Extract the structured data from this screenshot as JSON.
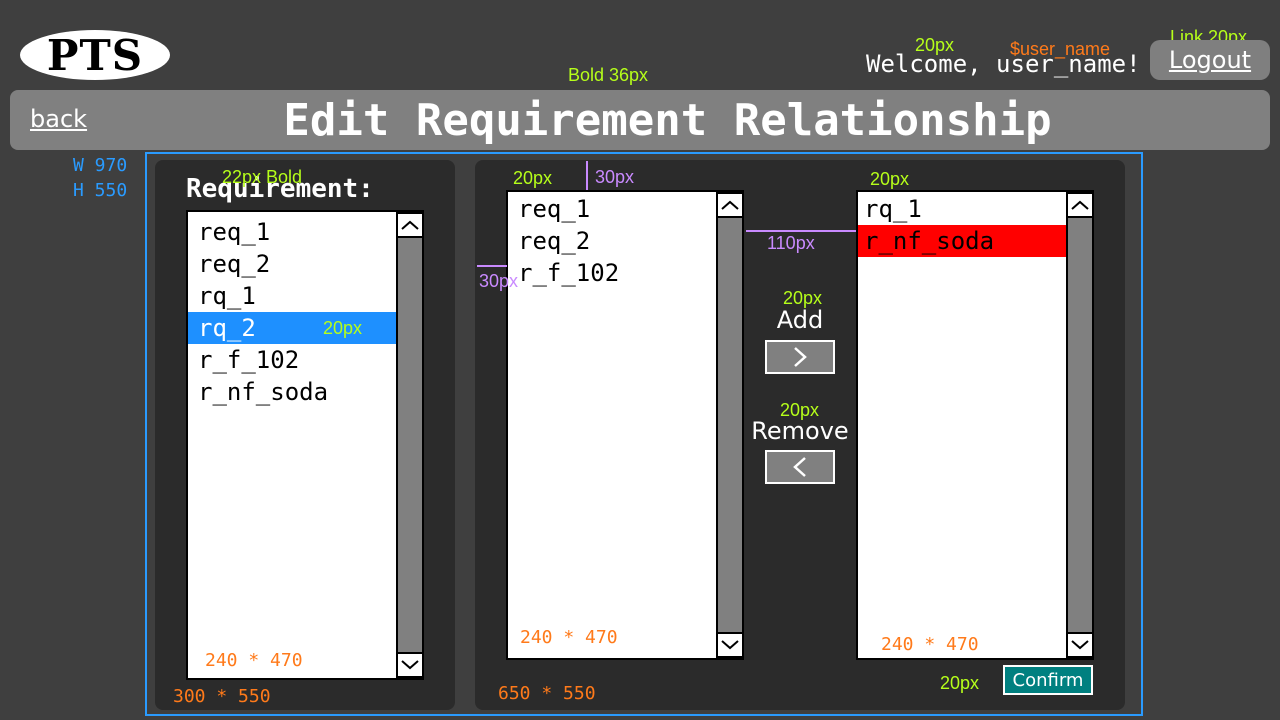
{
  "app": {
    "logo": "PTS",
    "page_title": "Edit Requirement Relationship",
    "back_label": "back"
  },
  "header": {
    "welcome": "Welcome, user_name!",
    "logout_label": "Logout"
  },
  "requirement_panel": {
    "heading": "Requirement:",
    "items": [
      "req_1",
      "req_2",
      "rq_1",
      "rq_2",
      "r_f_102",
      "r_nf_soda"
    ],
    "selected": "rq_2"
  },
  "source_list": {
    "items": [
      "req_1",
      "req_2",
      "r_f_102"
    ]
  },
  "target_list": {
    "items": [
      "rq_1",
      "r_nf_soda"
    ],
    "highlighted": "r_nf_soda"
  },
  "actions": {
    "add_label": "Add",
    "remove_label": "Remove",
    "confirm_label": "Confirm"
  },
  "annotations": {
    "bold36": "Bold 36px",
    "link20": "Link 20px",
    "px20": "20px",
    "user_name_var": "$user_name",
    "bold22": "22px Bold",
    "w970": "W 970",
    "h550": "H 550",
    "px30": "30px",
    "px110": "110px",
    "size_list": "240 * 470",
    "size_left_panel": "300 * 550",
    "size_right_panel": "650 * 550"
  },
  "colors": {
    "background": "#3f3f3f",
    "panel": "#2b2b2b",
    "selected": "#1e90ff",
    "highlight_red": "#ff0000",
    "confirm": "#008080",
    "annotation_green": "#b6ff1a",
    "annotation_orange": "#ff7a1a",
    "annotation_purple": "#c98aff",
    "frame_blue": "#2a9bff"
  }
}
